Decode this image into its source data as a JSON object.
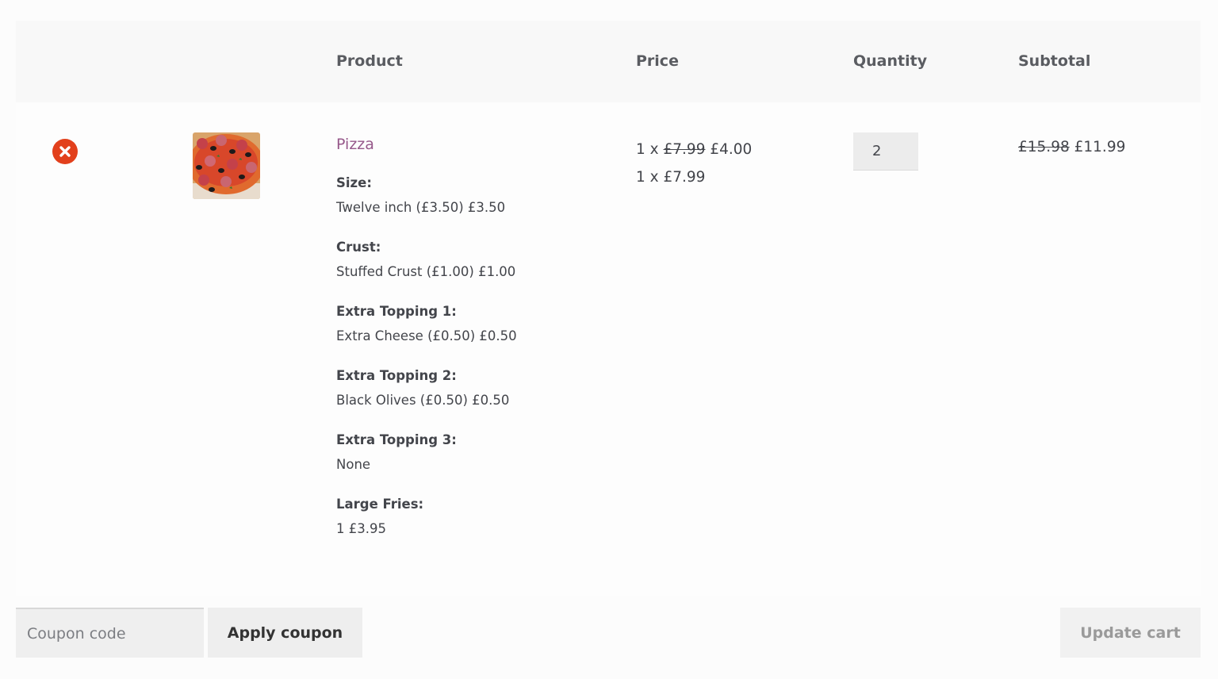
{
  "table": {
    "headers": {
      "product": "Product",
      "price": "Price",
      "quantity": "Quantity",
      "subtotal": "Subtotal"
    }
  },
  "cart_item": {
    "name": "Pizza",
    "meta": [
      {
        "label": "Size:",
        "value": "Twelve inch (£3.50) £3.50"
      },
      {
        "label": "Crust:",
        "value": "Stuffed Crust (£1.00) £1.00"
      },
      {
        "label": "Extra Topping 1:",
        "value": "Extra Cheese (£0.50) £0.50"
      },
      {
        "label": "Extra Topping 2:",
        "value": "Black Olives (£0.50) £0.50"
      },
      {
        "label": "Extra Topping 3:",
        "value": "None"
      },
      {
        "label": "Large Fries:",
        "value": "1 £3.95"
      }
    ],
    "price_line1_prefix": "1 x",
    "price_line1_old": "£7.99",
    "price_line1_new": "£4.00",
    "price_line2": "1 x £7.99",
    "quantity": "2",
    "subtotal_old": "£15.98",
    "subtotal_new": "£11.99"
  },
  "actions": {
    "coupon_placeholder": "Coupon code",
    "apply_coupon_label": "Apply coupon",
    "update_cart_label": "Update cart"
  },
  "colors": {
    "accent_link": "#96588a",
    "remove": "#e2401c"
  },
  "icons": {
    "remove": "close-circle-icon",
    "thumbnail": "pizza-image"
  }
}
